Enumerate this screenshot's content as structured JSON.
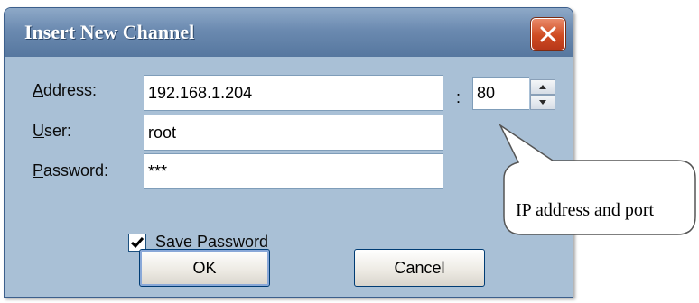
{
  "dialog": {
    "title": "Insert New Channel",
    "address": {
      "label_accel": "A",
      "label_rest": "ddress:",
      "value": "192.168.1.204"
    },
    "port": {
      "separator": ":",
      "value": "80"
    },
    "user": {
      "label_accel": "U",
      "label_rest": "ser:",
      "value": "root"
    },
    "password": {
      "label_accel": "P",
      "label_rest": "assword:",
      "value": "***"
    },
    "save_password": {
      "label_accel": "S",
      "label_rest": "ave Password",
      "checked": true
    },
    "ok_label": "OK",
    "cancel_label": "Cancel"
  },
  "annotation": {
    "text": "IP address and port"
  },
  "colors": {
    "dialog_bg": "#a9c0d6",
    "titlebar": "#6b8ab0",
    "close_red": "#cf4b22"
  }
}
